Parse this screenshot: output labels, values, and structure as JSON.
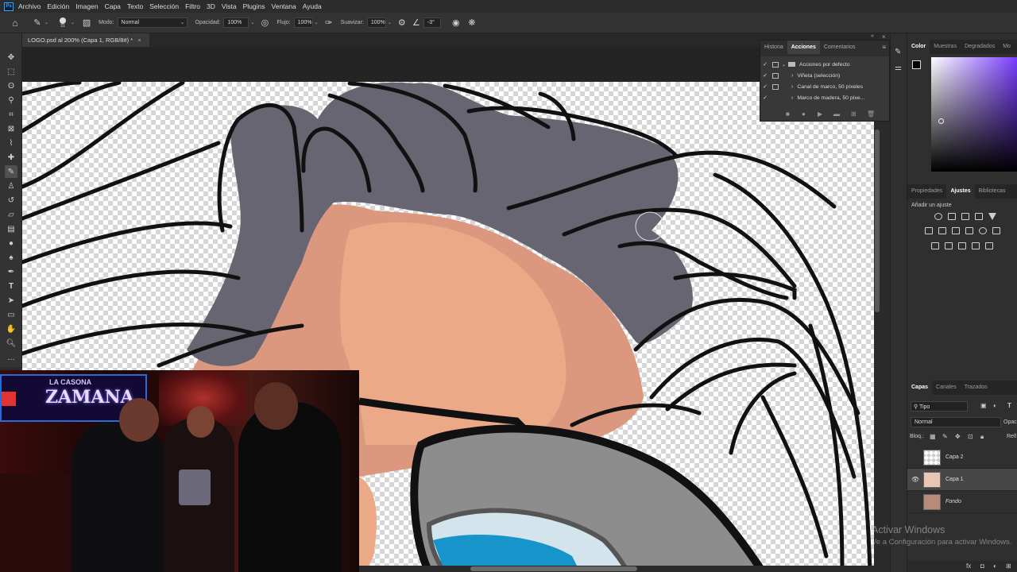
{
  "menu": [
    "Archivo",
    "Edición",
    "Imagen",
    "Capa",
    "Texto",
    "Selección",
    "Filtro",
    "3D",
    "Vista",
    "Plugins",
    "Ventana",
    "Ayuda"
  ],
  "options": {
    "brush_size": "31",
    "mode_label": "Modo:",
    "mode_value": "Normal",
    "opacity_label": "Opacidad:",
    "opacity_value": "100%",
    "flow_label": "Flujo:",
    "flow_value": "100%",
    "smooth_label": "Suavizar:",
    "smooth_value": "100%",
    "angle_value": "-3°"
  },
  "document_tab": "LOGO.psd al 200% (Capa 1, RGB/8#) *",
  "actions_panel": {
    "tabs": [
      "Historia",
      "Acciones",
      "Comentarios"
    ],
    "active_tab": "Acciones",
    "items": [
      "Acciones por defecto",
      "Viñeta (selección)",
      "Canal de marco, 50 píxeles",
      "Marco de madera, 50 píxe..."
    ]
  },
  "color_panel": {
    "tabs": [
      "Color",
      "Muestras",
      "Degradados",
      "Mo"
    ],
    "active_tab": "Color"
  },
  "adjust_panel": {
    "tabs": [
      "Propiedades",
      "Ajustes",
      "Bibliotecas"
    ],
    "active_tab": "Ajustes",
    "hint": "Añadir un ajuste"
  },
  "layers_panel": {
    "tabs": [
      "Capas",
      "Canales",
      "Trazados"
    ],
    "active_tab": "Capas",
    "filter": "Tipo",
    "blend_mode": "Normal",
    "opacity_cut": "Opac",
    "lock_label": "Bloq.:",
    "fill_cut": "Rell",
    "layers": [
      {
        "name": "Capa 2",
        "visible": false,
        "selected": false
      },
      {
        "name": "Capa 1",
        "visible": true,
        "selected": true
      },
      {
        "name": "Fondo",
        "visible": false,
        "selected": false
      }
    ]
  },
  "webcam": {
    "sign_top": "LA CASONA",
    "sign_main": "ZAMANA"
  },
  "watermark": {
    "line1": "Activar Windows",
    "line2": "Ve a Configuración para activar Windows."
  }
}
